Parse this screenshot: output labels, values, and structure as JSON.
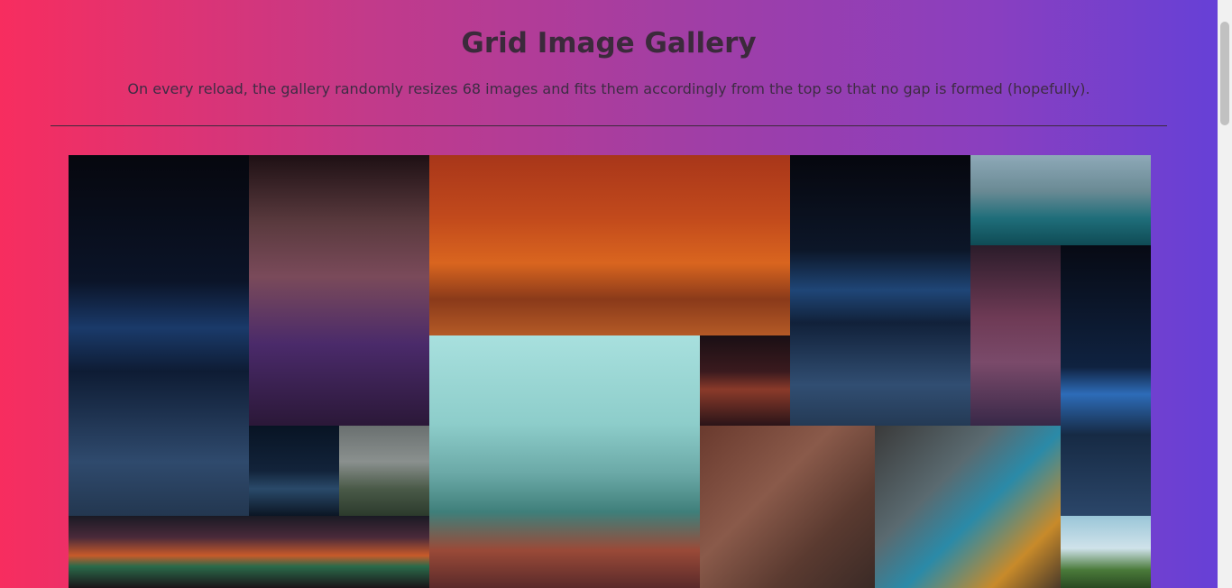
{
  "header": {
    "title": "Grid Image Gallery",
    "subtitle": "On every reload, the gallery randomly resizes 68 images and fits them accordingly from the top so that no gap is formed (hopefully)."
  },
  "gallery": {
    "tiles": [
      {
        "name": "night-bridge-photo",
        "bg": "linear-gradient(180deg,#06070e 0%,#0b1428 35%,#1a3a6a 48%,#0e1c34 60%,#2f4a6d 85%,#233750 100%)"
      },
      {
        "name": "neon-alley-photo",
        "bg": "linear-gradient(180deg,#1e1014 0%,#5a3a3e 25%,#7a4a5a 45%,#4a2a6a 70%,#2b1838 100%)"
      },
      {
        "name": "autumn-forest-photo",
        "bg": "linear-gradient(180deg,#a8361a 0%,#c24a1c 35%,#d9651f 60%,#8a3a1a 80%,#b45a26 100%)"
      },
      {
        "name": "night-bridge-photo-2",
        "bg": "linear-gradient(180deg,#06070e 0%,#0c1628 35%,#1f4677 50%,#11213a 62%,#314e72 85%,#243a55 100%)"
      },
      {
        "name": "mountain-lake-photo",
        "bg": "linear-gradient(180deg,#8ea9b8 0%,#6a8a94 40%,#1f6e7a 70%,#0f4b55 100%)"
      },
      {
        "name": "neon-street-photo",
        "bg": "linear-gradient(180deg,#2b1c2a 0%,#6e3a55 40%,#7a4a6a 65%,#382848 100%)"
      },
      {
        "name": "night-bridge-photo-3",
        "bg": "linear-gradient(180deg,#070a14 0%,#0f2240 45%,#2d6cb8 55%,#162a44 70%,#2b4669 100%)"
      },
      {
        "name": "pagoda-photo",
        "bg": "linear-gradient(180deg,#a8e0de 0%,#8dcdca 35%,#6aa8a6 55%,#3f7f7a 70%,#9a4a38 85%,#5a2a2a 100%)"
      },
      {
        "name": "tokyo-shop-photo",
        "bg": "linear-gradient(180deg,#1a0f14 0%,#3a1a1e 40%,#8a3a2a 60%,#2a1418 100%)"
      },
      {
        "name": "highway-lights-photo",
        "bg": "linear-gradient(180deg,#081424 0%,#12233a 50%,#2a4a6a 70%,#0b1624 100%)"
      },
      {
        "name": "misty-river-photo",
        "bg": "linear-gradient(180deg,#6a7070 0%,#8a908e 40%,#4a5a48 70%,#2c3a2c 100%)"
      },
      {
        "name": "graffiti-wall-photo",
        "bg": "linear-gradient(135deg,#6a3a2e 0%,#8a5a4a 40%,#5a3a30 70%,#3a2a26 100%)"
      },
      {
        "name": "graffiti-woman-photo",
        "bg": "linear-gradient(135deg,#3a3a3a 0%,#5a6a70 35%,#2a8aa8 55%,#c88a2a 80%,#4a3a2a 100%)"
      },
      {
        "name": "neon-storefront-photo",
        "bg": "linear-gradient(180deg,#1a1a24 0%,#4a2a3a 30%,#c85a2a 55%,#2a6a4a 70%,#1a1418 100%)"
      },
      {
        "name": "countryside-photo",
        "bg": "linear-gradient(180deg,#9ac6d8 0%,#cfe2ea 45%,#4a7a3a 75%,#2a4a22 100%)"
      }
    ]
  }
}
